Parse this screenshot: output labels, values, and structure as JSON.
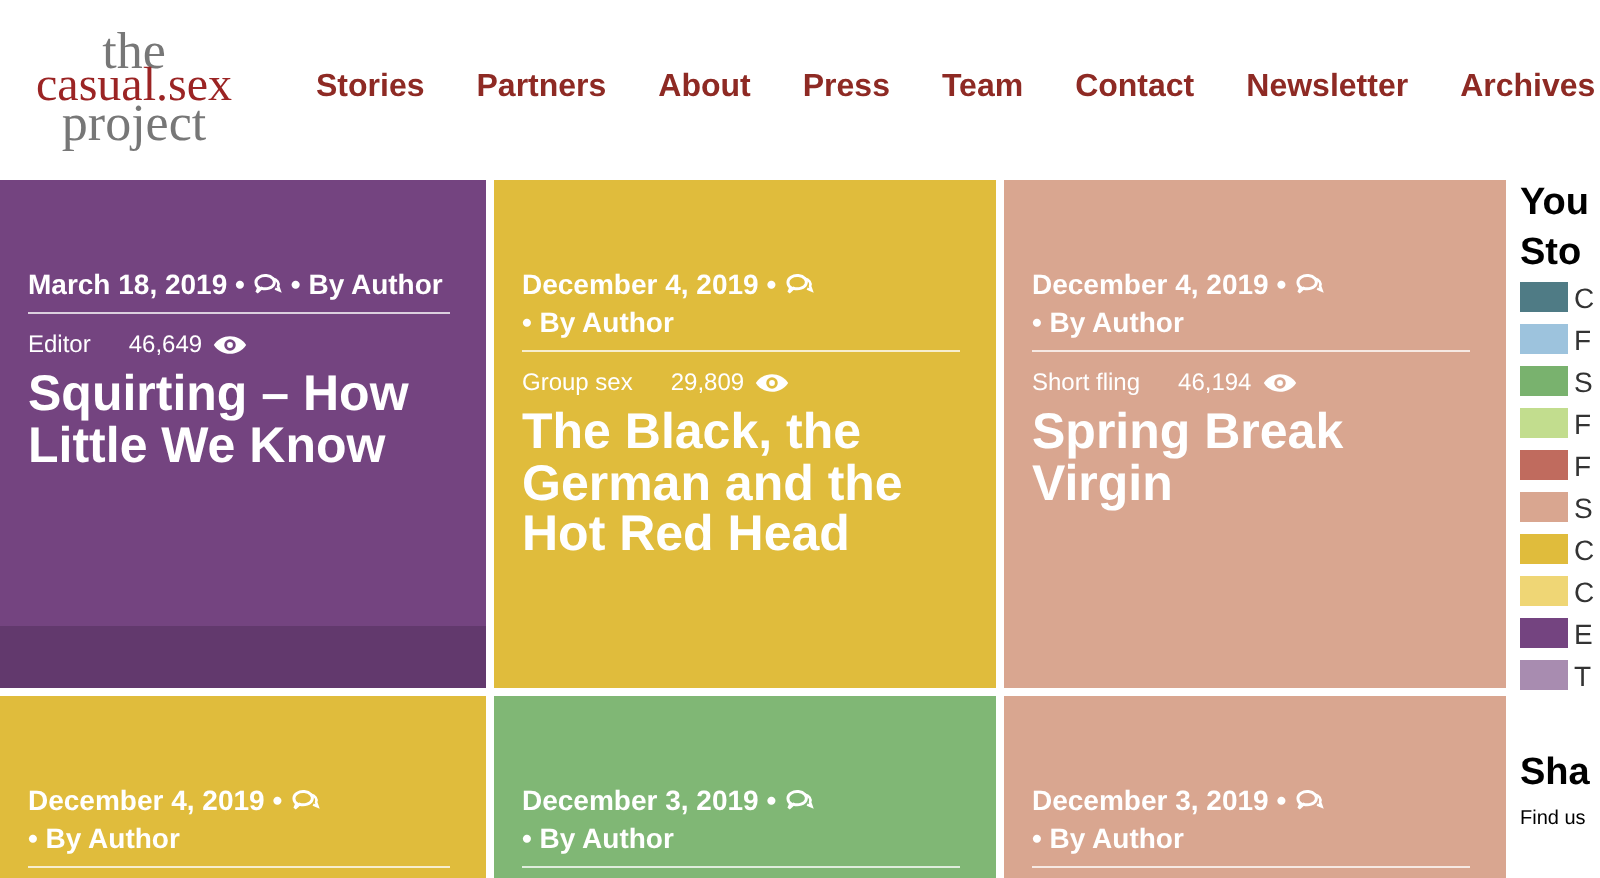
{
  "logo": {
    "lines": [
      "the",
      "casual.sex",
      "project"
    ]
  },
  "nav": [
    "Stories",
    "Partners",
    "About",
    "Press",
    "Team",
    "Contact",
    "Newsletter",
    "Archives"
  ],
  "cards": [
    {
      "color": "#744480",
      "date": "March 18, 2019 •",
      "author": "• By Author",
      "category": "Editor",
      "views": "46,649",
      "title": "Squirting – How Little We Know",
      "shaded_footer": true
    },
    {
      "color": "#e0bc3c",
      "date": "December 4, 2019 •",
      "author": "• By Author",
      "category": "Group sex",
      "views": "29,809",
      "title": "The Black, the German and the Hot Red Head",
      "shaded_footer": false
    },
    {
      "color": "#d9a690",
      "date": "December 4, 2019 •",
      "author": "• By Author",
      "category": "Short fling",
      "views": "46,194",
      "title": "Spring Break Virgin",
      "shaded_footer": false
    },
    {
      "color": "#e0bc3c",
      "date": "December 4, 2019 •",
      "author": "• By Author"
    },
    {
      "color": "#80b775",
      "date": "December 3, 2019 •",
      "author": "• By Author"
    },
    {
      "color": "#d9a690",
      "date": "December 3, 2019 •",
      "author": "• By Author"
    }
  ],
  "sidebar": {
    "heading_lines": [
      "You",
      "Sto"
    ],
    "legend": [
      {
        "label": "C",
        "color": "#4f7b85"
      },
      {
        "label": "F",
        "color": "#9dc3dd"
      },
      {
        "label": "S",
        "color": "#79b26e"
      },
      {
        "label": "F",
        "color": "#c2dd8e"
      },
      {
        "label": "F",
        "color": "#c06b5e"
      },
      {
        "label": "S",
        "color": "#d9a690"
      },
      {
        "label": "C",
        "color": "#e0bc3c"
      },
      {
        "label": "C",
        "color": "#efd675"
      },
      {
        "label": "E",
        "color": "#744480"
      },
      {
        "label": "T",
        "color": "#a88cb0"
      }
    ],
    "share_heading": "Sha",
    "share_text": "Find us"
  }
}
